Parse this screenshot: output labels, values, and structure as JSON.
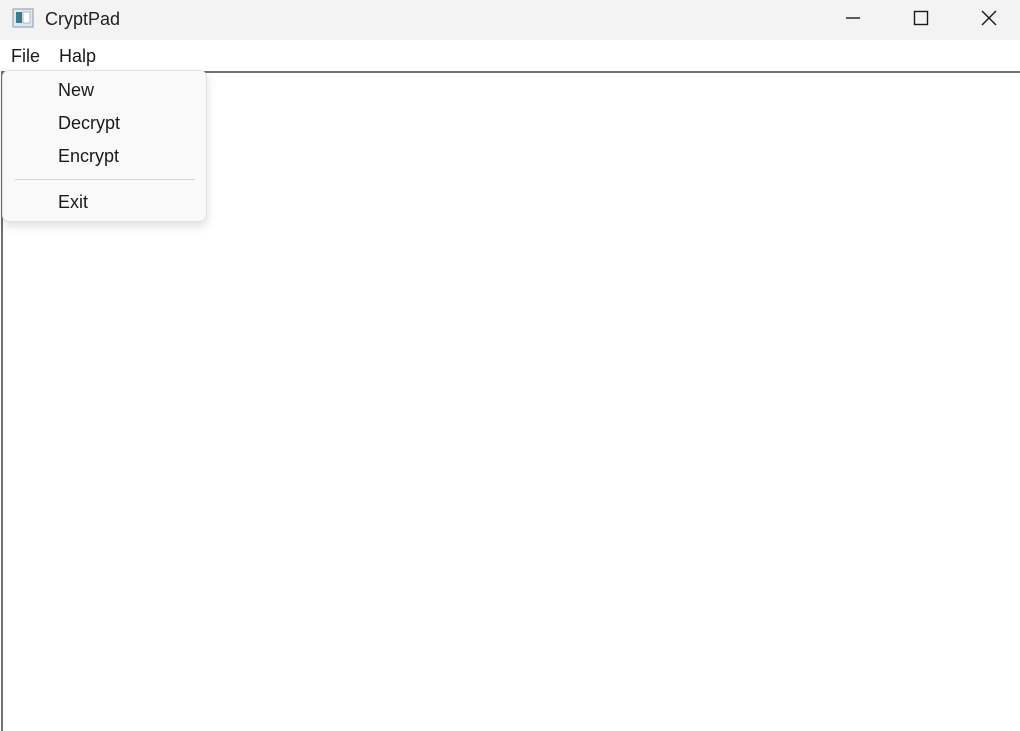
{
  "window": {
    "title": "CryptPad"
  },
  "caption_buttons": {
    "minimize_icon": "minimize-icon",
    "maximize_icon": "maximize-icon",
    "close_icon": "close-icon"
  },
  "menubar": {
    "items": [
      {
        "label": "File"
      },
      {
        "label": "Halp"
      }
    ]
  },
  "file_menu": {
    "items": [
      {
        "label": "New"
      },
      {
        "label": "Decrypt"
      },
      {
        "label": "Encrypt"
      },
      {
        "label": "Exit"
      }
    ]
  },
  "editor": {
    "text": ""
  }
}
